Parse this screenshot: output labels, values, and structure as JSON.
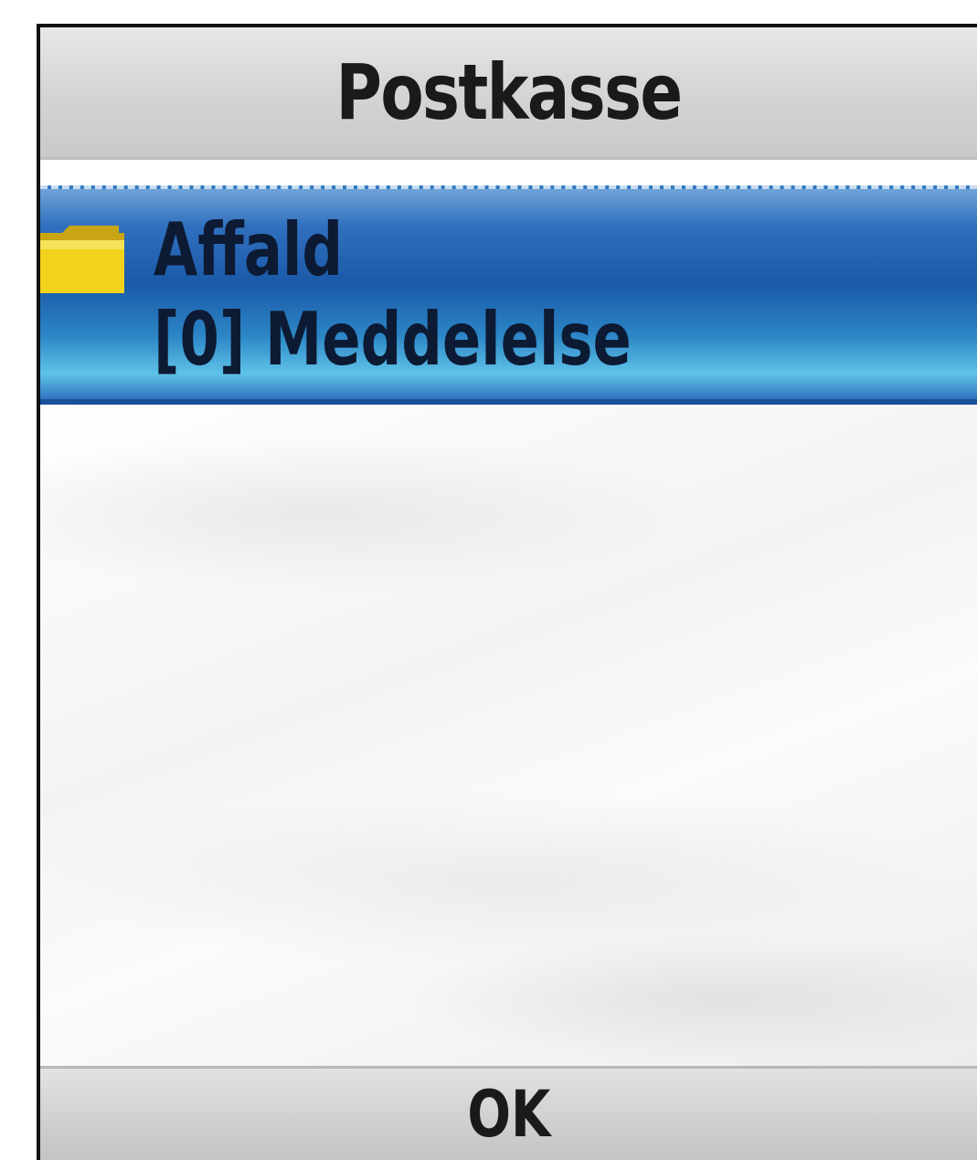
{
  "header": {
    "title": "Postkasse"
  },
  "list": {
    "items": [
      {
        "icon": "folder-icon",
        "title": "Affald",
        "subtitle": "[0] Meddelelse",
        "selected": true
      }
    ]
  },
  "softkeys": {
    "center": "OK"
  },
  "colors": {
    "selection": "#1a5aa8",
    "folder": "#f2d21b"
  }
}
